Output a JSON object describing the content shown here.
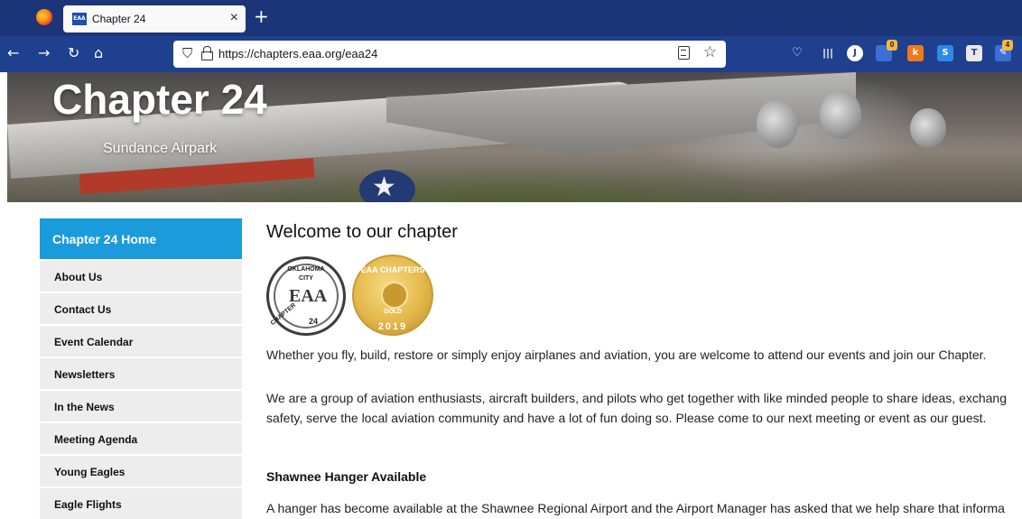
{
  "browser": {
    "tab_title": "Chapter 24",
    "tab_favicon_text": "EAA",
    "url": "https://chapters.eaa.org/eaa24",
    "extension_badges": [
      "0",
      "4"
    ],
    "extension_letters": [
      "J",
      "S",
      "T"
    ],
    "icons": [
      "firefox-logo",
      "close",
      "new-tab",
      "back",
      "forward",
      "reload",
      "home",
      "shield",
      "lock",
      "reader-view",
      "bookmark-star",
      "pocket",
      "library",
      "extensions"
    ]
  },
  "hero": {
    "title": "Chapter 24",
    "subtitle": "Sundance Airpark"
  },
  "sidebar": {
    "home": "Chapter 24 Home",
    "items": [
      {
        "label": "About Us"
      },
      {
        "label": "Contact Us"
      },
      {
        "label": "Event Calendar"
      },
      {
        "label": "Newsletters"
      },
      {
        "label": "In the News"
      },
      {
        "label": "Meeting Agenda"
      },
      {
        "label": "Young Eagles"
      },
      {
        "label": "Eagle Flights"
      }
    ]
  },
  "main": {
    "title": "Welcome to our chapter",
    "logo_okc": {
      "top": "OKLAHOMA",
      "city": "CITY",
      "letters": "EAA",
      "left": "CHAPTER",
      "number": "24"
    },
    "logo_gold": {
      "top": "EAA CHAPTERS",
      "middle": "GOLD",
      "year": "2019"
    },
    "intro": "Whether you fly, build, restore or simply enjoy airplanes and aviation, you are welcome to attend our events and join our Chapter.",
    "about_line1": "We are a group of aviation enthusiasts, aircraft builders, and pilots who get together with like minded people to share ideas, exchang",
    "about_line2": "safety, serve the local aviation community and have a lot of fun doing so. Please come to our next meeting or event as our guest.",
    "hangar_heading": "Shawnee Hanger Available",
    "hangar_text": "A hanger has become available at the Shawnee Regional Airport and the Airport Manager has asked that we help share that informa"
  },
  "colors": {
    "tab_strip": "#1b3578",
    "toolbar": "#1f3f8f",
    "sidebar_home": "#1a9bdc",
    "sidebar_item": "#ededed"
  }
}
